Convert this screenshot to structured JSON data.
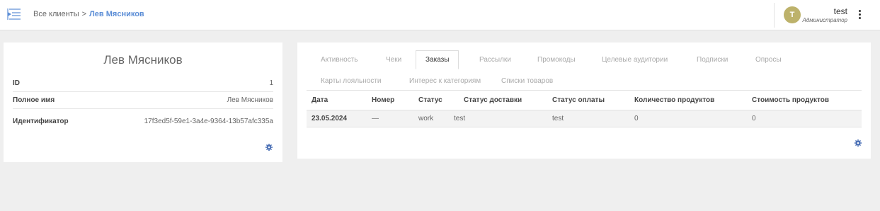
{
  "header": {
    "breadcrumb_root": "Все клиенты",
    "breadcrumb_sep": ">",
    "breadcrumb_current": "Лев Мясников",
    "user_initial": "T",
    "user_name": "test",
    "user_role": "Администратор"
  },
  "profile": {
    "name": "Лев Мясников",
    "rows": [
      {
        "key": "ID",
        "value": "1"
      },
      {
        "key": "Полное имя",
        "value": "Лев Мясников"
      },
      {
        "key": "Идентификатор",
        "value": "17f3ed5f-59e1-3a4e-9364-13b57afc335a"
      }
    ]
  },
  "tabs": [
    {
      "label": "Активность"
    },
    {
      "label": "Чеки"
    },
    {
      "label": "Заказы",
      "active": true
    },
    {
      "label": "Рассылки"
    },
    {
      "label": "Промокоды"
    },
    {
      "label": "Целевые аудитории"
    },
    {
      "label": "Подписки"
    },
    {
      "label": "Опросы"
    },
    {
      "label": "Карты лояльности"
    },
    {
      "label": "Интерес к категориям"
    },
    {
      "label": "Списки товаров"
    }
  ],
  "orders": {
    "columns": [
      "Дата",
      "Номер",
      "Статус",
      "Статус доставки",
      "Статус оплаты",
      "Количество продуктов",
      "Стоимость продуктов"
    ],
    "rows": [
      [
        "23.05.2024",
        "—",
        "work",
        "test",
        "test",
        "0",
        "0"
      ]
    ]
  },
  "colors": {
    "accent": "#5b8dd6",
    "avatar": "#bdb26b",
    "gear": "#4a6fb5"
  },
  "icons": {
    "menu": "menu-toggle-icon",
    "more": "kebab-menu-icon",
    "settings": "gear-icon"
  }
}
